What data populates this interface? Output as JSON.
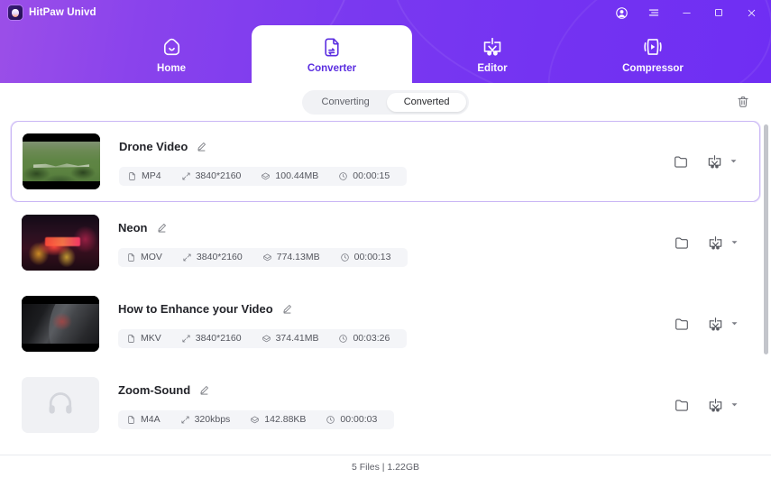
{
  "window": {
    "app_title": "HitPaw Univd",
    "logo_icon": "hitpaw-logo",
    "controls": [
      {
        "name": "account-icon",
        "label": "Account"
      },
      {
        "name": "menu-icon",
        "label": "Menu"
      },
      {
        "name": "minimize-icon",
        "label": "Minimize"
      },
      {
        "name": "maximize-icon",
        "label": "Maximize"
      },
      {
        "name": "close-icon",
        "label": "Close"
      }
    ]
  },
  "nav": {
    "tabs": [
      {
        "label": "Home",
        "icon": "home-icon",
        "active": false
      },
      {
        "label": "Converter",
        "icon": "converter-icon",
        "active": true
      },
      {
        "label": "Editor",
        "icon": "editor-icon",
        "active": false
      },
      {
        "label": "Compressor",
        "icon": "compressor-icon",
        "active": false
      }
    ],
    "active_tab": "Converter"
  },
  "subbar": {
    "segments": [
      {
        "label": "Converting",
        "active": false
      },
      {
        "label": "Converted",
        "active": true
      }
    ],
    "trash_icon": "trash-icon",
    "trash_label": "Clear list"
  },
  "list": {
    "rows": [
      {
        "title": "Drone Video",
        "selected": true,
        "thumb_type": "video",
        "thumb_style": "pic-drone",
        "format": "MP4",
        "resolution": "3840*2160",
        "size": "100.44MB",
        "duration": "00:00:15"
      },
      {
        "title": "Neon",
        "selected": false,
        "thumb_type": "video",
        "thumb_style": "pic-neon",
        "format": "MOV",
        "resolution": "3840*2160",
        "size": "774.13MB",
        "duration": "00:00:13"
      },
      {
        "title": "How to Enhance your Video",
        "selected": false,
        "thumb_type": "video",
        "thumb_style": "pic-mkv",
        "format": "MKV",
        "resolution": "3840*2160",
        "size": "374.41MB",
        "duration": "00:03:26"
      },
      {
        "title": "Zoom-Sound",
        "selected": false,
        "thumb_type": "audio",
        "thumb_style": "",
        "format": "M4A",
        "resolution": "320kbps",
        "size": "142.88KB",
        "duration": "00:00:03"
      }
    ],
    "row_actions": {
      "open_folder_icon": "folder-icon",
      "edit_icon": "editor-icon",
      "dropdown_icon": "chevron-down-icon"
    },
    "meta_icons": {
      "format": "file-icon",
      "resolution": "resize-icon",
      "size": "disk-icon",
      "duration": "clock-icon"
    },
    "rename_icon": "pencil-icon"
  },
  "footer": {
    "status": "5 Files | 1.22GB"
  },
  "colors": {
    "header_gradient_start": "#9b4fe8",
    "header_gradient_end": "#6f2ef3",
    "active_tab_text": "#5b2ee0",
    "selected_row_border": "#c9b6f5",
    "meta_chip_bg": "#f4f5f8"
  }
}
